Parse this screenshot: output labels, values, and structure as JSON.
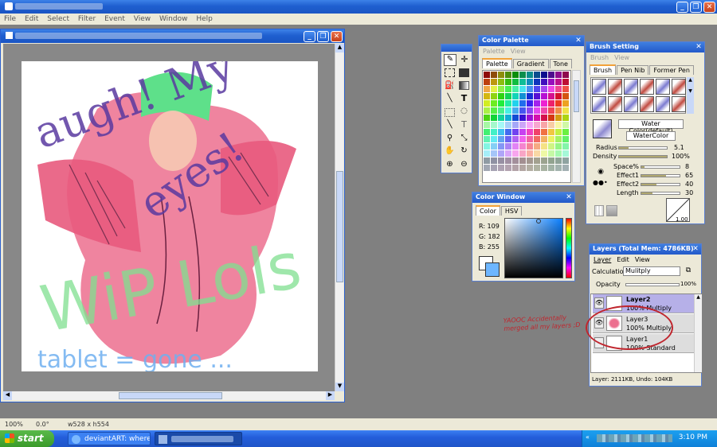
{
  "menu": [
    "File",
    "Edit",
    "Select",
    "Filter",
    "Event",
    "View",
    "Window",
    "Help"
  ],
  "doc": {
    "scroll_h": "",
    "scroll_v": ""
  },
  "doodle": {
    "line1": "augh! My",
    "line2": "eyes!",
    "line3": "WiP Lols",
    "line4": "tablet = gone ..."
  },
  "color_palette": {
    "title": "Color Palette",
    "submenu": [
      "Palette",
      "View"
    ],
    "tabs": [
      "Palette",
      "Gradient",
      "Tone"
    ]
  },
  "brush": {
    "title": "Brush Setting",
    "submenu": [
      "Brush",
      "View"
    ],
    "tabs": [
      "Brush",
      "Pen Nib",
      "Former Pen"
    ],
    "preset_primary": "Water Color(default)",
    "preset_secondary": "WaterColor",
    "params": [
      {
        "label": "Radius",
        "value": "5.1",
        "fill": 0.2
      },
      {
        "label": "Density",
        "value": "100%",
        "fill": 1.0
      }
    ],
    "effects": [
      {
        "label": "Space%",
        "value": "8",
        "fill": 0.08
      },
      {
        "label": "Effect1",
        "value": "65",
        "fill": 0.65
      },
      {
        "label": "Effect2",
        "value": "40",
        "fill": 0.4
      },
      {
        "label": "Length",
        "value": "30",
        "fill": 0.3
      }
    ],
    "curve_value": "1.00"
  },
  "color_window": {
    "title": "Color Window",
    "tabs": [
      "Color",
      "HSV"
    ],
    "r": "R: 109",
    "g": "G: 182",
    "b": "B: 255",
    "current": "#6db6ff"
  },
  "layers": {
    "title": "Layers (Total Mem: 4786KB)",
    "menu": [
      "Layer",
      "Edit",
      "View"
    ],
    "calc_label": "Calculation",
    "calc_value": "Mulitply",
    "opacity_label": "Opacity",
    "opacity_value": "100%",
    "rows": [
      {
        "name": "Layer2",
        "mode": "100% Multiply"
      },
      {
        "name": "Layer3",
        "mode": "100% Multiply"
      },
      {
        "name": "Layer1",
        "mode": "100% Standard"
      }
    ],
    "status": "Layer: 2111KB, Undo: 104KB"
  },
  "annotation": "YAOOC Accidentally merged all my layers ;D",
  "status_bar": {
    "zoom": "100%",
    "angle": "0.0°",
    "size": "w528 x h554"
  },
  "taskbar": {
    "start": "start",
    "task1": "deviantART: where A...",
    "time": "3:10 PM"
  },
  "colors": {
    "accent": "#245edb",
    "selected_color": "#6db6ff"
  }
}
